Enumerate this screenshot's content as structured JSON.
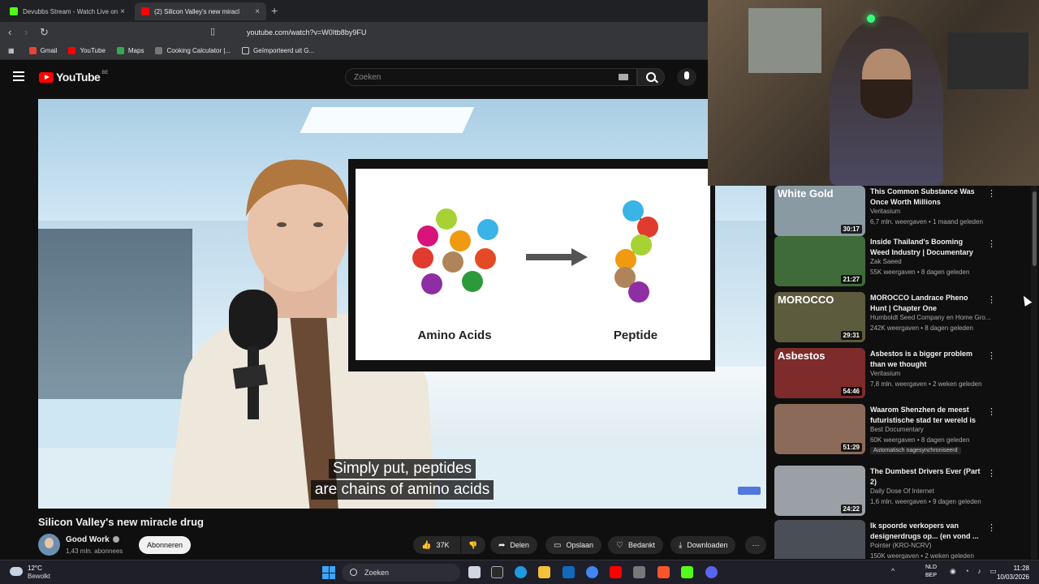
{
  "browser": {
    "tabs": [
      {
        "label": "Devubbs Stream - Watch Live on",
        "color": "#53fc18"
      },
      {
        "label": "(2) Silicon Valley's new miracl",
        "color": "#ff0000"
      }
    ],
    "url": "youtube.com/watch?v=W0Itb8by9FU",
    "bookmarks": [
      "Gmail",
      "YouTube",
      "Maps",
      "Cooking Calculator |...",
      "Geïmporteerd uit G..."
    ]
  },
  "youtube": {
    "logo_text": "YouTube",
    "logo_region": "BE",
    "search_placeholder": "Zoeken"
  },
  "player": {
    "watermark": "good",
    "slide": {
      "left_label": "Amino Acids",
      "right_label": "Peptide"
    },
    "subtitle_line1": "Simply put, peptides",
    "subtitle_line2": "are chains of amino acids"
  },
  "video": {
    "title": "Silicon Valley's new miracle drug",
    "channel": "Good Work",
    "subscribers": "1,43 mln. abonnees",
    "subscribe_label": "Abonneren",
    "likes": "37K",
    "share_label": "Delen",
    "save_label": "Opslaan",
    "thanks_label": "Bedankt",
    "download_label": "Downloaden"
  },
  "recommendations": [
    {
      "thumb_text": "White Gold",
      "duration": "30:17",
      "title": "This Common Substance Was Once Worth Millions",
      "channel": "Veritasium",
      "meta": "6,7 mln. weergaven • 1 maand geleden",
      "thumb_color": "#8a9aa2"
    },
    {
      "thumb_text": "",
      "duration": "21:27",
      "title": "Inside Thailand's Booming Weed Industry | Documentary",
      "channel": "Zak Saeed",
      "meta": "55K weergaven • 8 dagen geleden",
      "thumb_color": "#3f6b3a"
    },
    {
      "thumb_text": "MOROCCO",
      "duration": "29:31",
      "title": "MOROCCO Landrace Pheno Hunt | Chapter One",
      "channel": "Humboldt Seed Company en Home Gro...",
      "meta": "242K weergaven • 8 dagen geleden",
      "thumb_color": "#5d5b3e"
    },
    {
      "thumb_text": "Asbestos",
      "duration": "54:46",
      "title": "Asbestos is a bigger problem than we thought",
      "channel": "Veritasium",
      "meta": "7,8 mln. weergaven • 2 weken geleden",
      "thumb_color": "#7e2b2b"
    },
    {
      "thumb_text": "",
      "duration": "51:29",
      "title": "Waarom Shenzhen de meest futuristische stad ter wereld is",
      "channel": "Best Documentary",
      "meta": "60K weergaven • 8 dagen geleden",
      "tag": "Automatisch nagesynchroniseerd",
      "thumb_color": "#8c6a5a"
    },
    {
      "thumb_text": "",
      "duration": "24:22",
      "title": "The Dumbest Drivers Ever (Part 2)",
      "channel": "Daily Dose Of Internet",
      "meta": "1,6 mln. weergaven • 9 dagen geleden",
      "thumb_color": "#9aa0a6"
    },
    {
      "thumb_text": "",
      "duration": "",
      "title": "Ik spoorde verkopers van designerdrugs op... (en vond ...",
      "channel": "Pointer (KRO-NCRV)",
      "meta": "150K weergaven • 2 weken geleden",
      "thumb_color": "#4a4f57"
    }
  ],
  "taskbar": {
    "temperature": "12°C",
    "weather": "Bewolkt",
    "search_label": "Zoeken",
    "lang_line1": "NLD",
    "lang_line2": "BEP",
    "time": "11:28",
    "date": "10/03/2026"
  }
}
